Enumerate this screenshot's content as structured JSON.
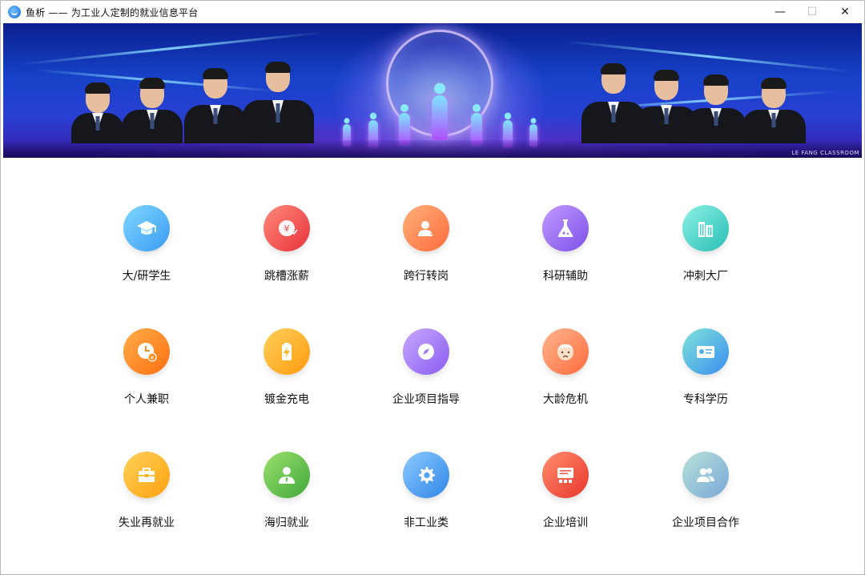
{
  "window": {
    "title": "鱼析 —— 为工业人定制的就业信息平台",
    "controls": {
      "minimize": "—",
      "maximize": "☐",
      "close": "✕"
    }
  },
  "banner": {
    "watermark": "LE FANG CLASSROOM"
  },
  "categories": [
    {
      "label": "大/研学生",
      "icon": "graduation-cap-icon",
      "color": "#4fb8f5"
    },
    {
      "label": "跳槽涨薪",
      "icon": "yen-growth-icon",
      "color": "#f2545b"
    },
    {
      "label": "跨行转岗",
      "icon": "user-transfer-icon",
      "color": "#ff8a4c"
    },
    {
      "label": "科研辅助",
      "icon": "flask-icon",
      "color": "#9b6ff0"
    },
    {
      "label": "冲刺大厂",
      "icon": "office-building-icon",
      "color": "#3fd1c4"
    },
    {
      "label": "个人兼职",
      "icon": "clock-yen-icon",
      "color": "#ff8a1f"
    },
    {
      "label": "镀金充电",
      "icon": "battery-charge-icon",
      "color": "#ffb21f"
    },
    {
      "label": "企业项目指导",
      "icon": "compass-icon",
      "color": "#a07cf2"
    },
    {
      "label": "大龄危机",
      "icon": "elder-face-icon",
      "color": "#ff8a5c"
    },
    {
      "label": "专科学历",
      "icon": "certificate-icon",
      "color": "#4fb0e8"
    },
    {
      "label": "失业再就业",
      "icon": "briefcase-icon",
      "color": "#ffb21f"
    },
    {
      "label": "海归就业",
      "icon": "person-suit-icon",
      "color": "#6cc24a"
    },
    {
      "label": "非工业类",
      "icon": "gear-icon",
      "color": "#4ea6f2"
    },
    {
      "label": "企业培训",
      "icon": "training-board-icon",
      "color": "#f25a4c"
    },
    {
      "label": "企业项目合作",
      "icon": "team-icon",
      "color": "#8ab4d6"
    }
  ]
}
